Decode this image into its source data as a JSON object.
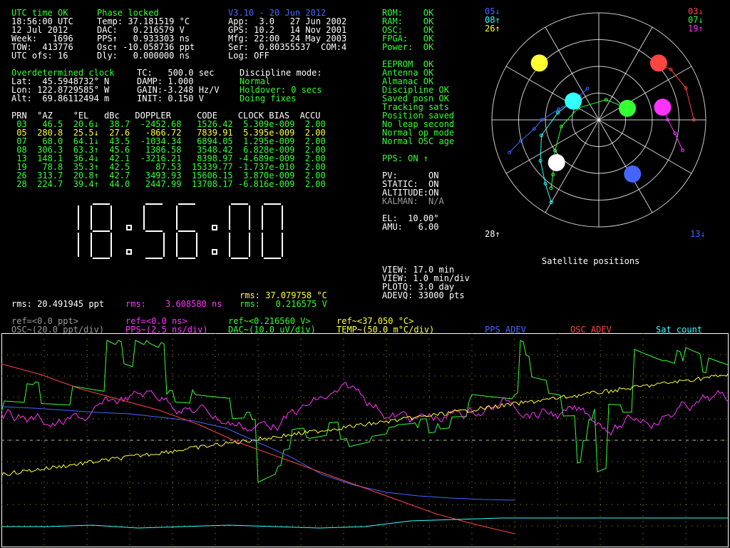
{
  "status": {
    "col1": [
      {
        "text": "UTC time OK",
        "color": "g"
      },
      {
        "text": "18:56:00 UTC",
        "color": "w"
      },
      {
        "text": "12 Jul 2012",
        "color": "w"
      },
      {
        "text": "Week:   1696",
        "color": "w"
      },
      {
        "text": "TOW:  413776",
        "color": "w"
      },
      {
        "text": "UTC ofs: 16",
        "color": "w"
      }
    ],
    "col2": [
      {
        "text": "Phase locked",
        "color": "g"
      },
      {
        "text": "Temp: 37.181519 °C",
        "color": "w"
      },
      {
        "text": "DAC:   0.216579 V",
        "color": "w"
      },
      {
        "text": "PPS↑   0.933303 ns",
        "color": "w"
      },
      {
        "text": "Osc↑ -10.058736 ppt",
        "color": "w"
      },
      {
        "text": "Dly:   0.000000 ns",
        "color": "w"
      }
    ],
    "col3": [
      {
        "text": "V3.10 - 20 Jun 2012",
        "color": "b"
      },
      {
        "text": "App:  3.0   27 Jun 2002",
        "color": "w"
      },
      {
        "text": "GPS: 10.2   14 Nov 2001",
        "color": "w"
      },
      {
        "text": "Mfg: 22:00  24 May 2003",
        "color": "w"
      },
      {
        "text": "Ser:  0.80355537  COM:4",
        "color": "w"
      },
      {
        "text": "Log: OFF",
        "color": "w"
      }
    ],
    "health": [
      {
        "text": "ROM:    OK",
        "color": "g"
      },
      {
        "text": "RAM:    OK",
        "color": "g"
      },
      {
        "text": "OSC:    OK",
        "color": "g"
      },
      {
        "text": "FPGA:   OK",
        "color": "g"
      },
      {
        "text": "Power:  OK",
        "color": "g"
      }
    ]
  },
  "position": {
    "lines": [
      {
        "text": "Overdetermined clock",
        "color": "g"
      },
      {
        "text": "Lat:  45.5948732° N",
        "color": "w"
      },
      {
        "text": "Lon: 122.8729585° W",
        "color": "w"
      },
      {
        "text": "Alt:  69.86112494 m",
        "color": "w"
      }
    ],
    "params": [
      {
        "text": "TC:   500.0 sec",
        "color": "w"
      },
      {
        "text": "DAMP: 1.000",
        "color": "w"
      },
      {
        "text": "GAIN:-3.248 Hz/V",
        "color": "w"
      },
      {
        "text": "INIT: 0.150 V",
        "color": "w"
      }
    ],
    "discipline": [
      {
        "text": "Discipline mode:",
        "color": "w"
      },
      {
        "text": "Normal",
        "color": "g"
      },
      {
        "text": "Holdover: 0 secs",
        "color": "g"
      },
      {
        "text": "Doing fixes",
        "color": "g"
      }
    ]
  },
  "checks": [
    {
      "text": "EEPROM  OK",
      "color": "g"
    },
    {
      "text": "Antenna OK",
      "color": "g"
    },
    {
      "text": "Almanac OK",
      "color": "g"
    },
    {
      "text": "Discipline OK",
      "color": "g"
    },
    {
      "text": "Saved posn OK",
      "color": "g"
    },
    {
      "text": "Tracking sats",
      "color": "g"
    },
    {
      "text": "Position saved",
      "color": "g"
    },
    {
      "text": "No leap second",
      "color": "g"
    },
    {
      "text": "Normal op mode",
      "color": "g"
    },
    {
      "text": "Normal OSC age",
      "color": "g"
    }
  ],
  "pps": "PPS: ON ↑",
  "modes": [
    {
      "text": "PV:      ON",
      "color": "w"
    },
    {
      "text": "STATIC:  ON",
      "color": "w"
    },
    {
      "text": "ALTITUDE:ON",
      "color": "w"
    },
    {
      "text": "KALMAN:  N/A",
      "color": "gr"
    }
  ],
  "elev": [
    {
      "text": "EL:  10.00°",
      "color": "w"
    },
    {
      "text": "AMU:   6.00",
      "color": "w"
    }
  ],
  "view": [
    {
      "text": "VIEW: 17.0 min",
      "color": "w"
    },
    {
      "text": "VIEW: 1.0 min/div",
      "color": "w"
    },
    {
      "text": "PLOTQ: 3.0 day",
      "color": "w"
    },
    {
      "text": "ADEVQ: 33000 pts",
      "color": "w"
    }
  ],
  "sat_table": {
    "header": "PRN  °AZ    °EL   dBc   DOPPLER     CODE    CLOCK BIAS  ACCU",
    "rows": [
      {
        "text": " 03   46.5  20.6↓  38.7  -2452.68   1526.42  5.309e-009  2.00",
        "color": "g"
      },
      {
        "text": " 05  280.8  25.5↓  27.6   -866.72   7839.91  5.395e-009  2.00",
        "color": "y"
      },
      {
        "text": " 07   68.0  64.1↓  43.5  -1034.34   6894.05  1.295e-009  2.00",
        "color": "g"
      },
      {
        "text": " 08  306.3  63.3↑  45.6   1386.58   3548.42  6.828e-009  2.00",
        "color": "g"
      },
      {
        "text": " 13  148.1  36.4↓  42.1  -3216.21   8398.97 -4.689e-009  2.00",
        "color": "g"
      },
      {
        "text": " 19   78.8  35.3↑  42.5     87.53  15339.77 -1.737e-010  2.00",
        "color": "g"
      },
      {
        "text": " 26  313.7  20.8↑  42.7   3493.93  15606.15  3.870e-009  2.00",
        "color": "g"
      },
      {
        "text": " 28  224.7  39.4↑  44.0   2447.99  13708.17 -6.816e-009  2.00",
        "color": "g"
      }
    ]
  },
  "big_clock": "18:56:00",
  "rms": {
    "ppt": "rms: 20.491945 ppt",
    "ns_label": "rms:",
    "ns_value": "3.608580 ns",
    "temp": "rms: 37.079758 °C",
    "volt": "rms:   0.216575 V"
  },
  "legend": [
    {
      "line1": "ref=<0.0 ppt>",
      "line2": "OSC~(20.0 ppt/div)",
      "color": "#9a9a9a"
    },
    {
      "line1": "ref=<0.0 ns>",
      "line2": "PPS~(2.5 ns/div)",
      "color": "#ff33ff"
    },
    {
      "line1": "ref~<0.216560 V>",
      "line2": "DAC~(10.0 uV/div)",
      "color": "#33ff33"
    },
    {
      "line1": "ref~<37.050 °C>",
      "line2": "TEMP~(50.0 m°C/div)",
      "color": "#ffff33"
    }
  ],
  "plot_labels": [
    {
      "text": "PPS ADEV",
      "color": "#4466ff"
    },
    {
      "text": "OSC ADEV",
      "color": "#ff4444"
    },
    {
      "text": "Sat count",
      "color": "#33ffff"
    }
  ],
  "sky": {
    "title": "Satellite positions",
    "corner_labels": [
      {
        "text": "05↓",
        "color": "#4466ff"
      },
      {
        "text": "08↑",
        "color": "#33ffff"
      },
      {
        "text": "26↑",
        "color": "#ffff33"
      },
      {
        "text": "03↓",
        "color": "#ff4444"
      },
      {
        "text": "07↓",
        "color": "#33ff33"
      },
      {
        "text": "19↑",
        "color": "#ff33ff"
      },
      {
        "text": "28↑",
        "color": "#ffffff"
      },
      {
        "text": "13↓",
        "color": "#4466ff"
      }
    ],
    "sats": [
      {
        "prn": "26",
        "az": 313.7,
        "el": 20.8,
        "color": "#ffff33"
      },
      {
        "prn": "03",
        "az": 46.5,
        "el": 20.6,
        "color": "#ff4444"
      },
      {
        "prn": "08",
        "az": 306.3,
        "el": 63.3,
        "color": "#33ffff"
      },
      {
        "prn": "07",
        "az": 68.0,
        "el": 64.1,
        "color": "#33ff33"
      },
      {
        "prn": "19",
        "az": 78.8,
        "el": 35.3,
        "color": "#ff33ff"
      },
      {
        "prn": "28",
        "az": 224.7,
        "el": 39.4,
        "color": "#ffffff"
      },
      {
        "prn": "13",
        "az": 148.1,
        "el": 36.4,
        "color": "#4466ff"
      }
    ]
  },
  "chart_data": {
    "type": "line",
    "x_divisions": 17,
    "y_divisions": 10,
    "series": [
      {
        "name": "PPS ADEV",
        "color": "#4466ff",
        "values": [
          570,
          572,
          575,
          578,
          580,
          585,
          590,
          600,
          620,
          640,
          665,
          680,
          690,
          695,
          698,
          700,
          701
        ]
      },
      {
        "name": "OSC ADEV",
        "color": "#ff4444",
        "values": [
          510,
          525,
          545,
          560,
          575,
          595,
          620,
          640,
          660,
          680,
          700,
          720,
          735,
          748
        ]
      },
      {
        "name": "Sat count",
        "color": "#33ffff",
        "values": [
          738,
          738,
          736,
          740,
          738,
          736,
          738,
          740,
          738,
          730,
          728,
          726,
          726,
          726,
          726,
          726,
          726
        ]
      }
    ]
  }
}
